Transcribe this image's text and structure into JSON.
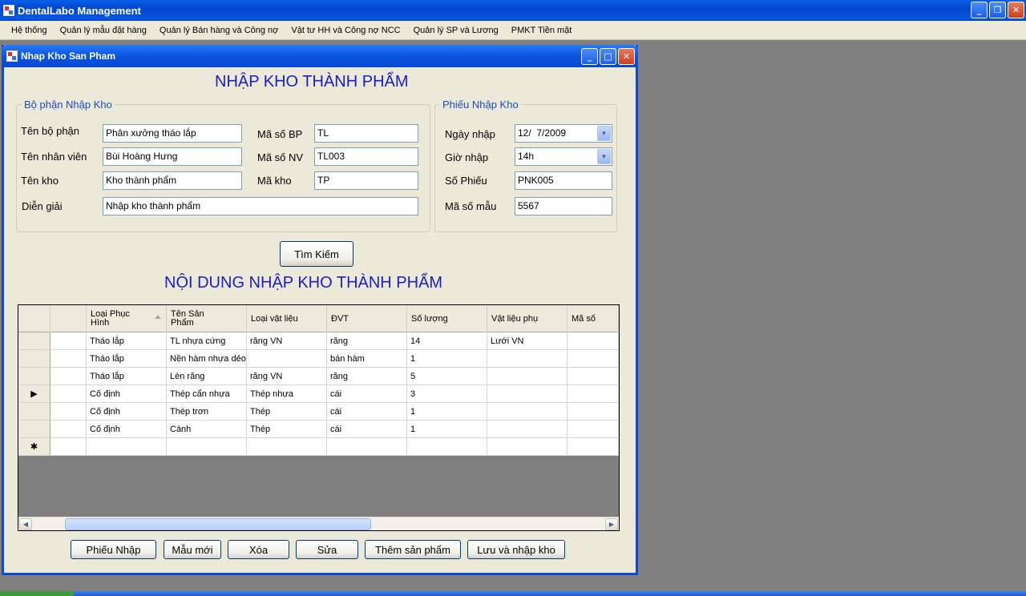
{
  "app": {
    "title": "DentalLabo Management"
  },
  "menu": [
    "Hệ thống",
    "Quản lý mẫu đặt hàng",
    "Quản lý Bán hàng và Công nợ",
    "Vật tư HH và Công nợ NCC",
    "Quản lý SP và Lương",
    "PMKT Tiền mặt"
  ],
  "window": {
    "title": "Nhap Kho San Pham"
  },
  "form": {
    "heading": "NHẬP KHO THÀNH PHẨM",
    "dept_group": "Bộ phận Nhập Kho",
    "receipt_group": "Phiếu Nhập Kho",
    "ten_bo_phan_label": "Tên bộ phận",
    "ten_bo_phan": "Phân xưởng tháo lắp",
    "ma_so_bp_label": "Mã số BP",
    "ma_so_bp": "TL",
    "ten_nhan_vien_label": "Tên nhân viên",
    "ten_nhan_vien": "Bùi Hoàng Hưng",
    "ma_so_nv_label": "Mã số NV",
    "ma_so_nv": "TL003",
    "ten_kho_label": "Tên kho",
    "ten_kho": "Kho thành phẩm",
    "ma_kho_label": "Mã kho",
    "ma_kho": "TP",
    "dien_giai_label": "Diễn giải",
    "dien_giai": "Nhập kho thành phẩm",
    "ngay_nhap_label": "Ngày nhập",
    "ngay_nhap": "12/  7/2009",
    "gio_nhap_label": "Giờ nhập",
    "gio_nhap": "14h",
    "so_phieu_label": "Số Phiếu",
    "so_phieu": "PNK005",
    "ma_so_mau_label": "Mã số mẫu",
    "ma_so_mau": "5567",
    "search_button": "Tìm Kiếm",
    "content_heading": "NỘI DUNG NHẬP KHO THÀNH PHẨM"
  },
  "grid": {
    "columns": [
      "",
      "Loại Phục\nHình",
      "Tên Sản\nPhẩm",
      "Loại vật liệu",
      "ĐVT",
      "Số lượng",
      "Vật liệu phụ",
      "Mã số"
    ],
    "rows": [
      [
        "",
        "Tháo lắp",
        "TL nhựa cứng",
        "răng VN",
        "răng",
        "14",
        "Lưới VN",
        ""
      ],
      [
        "",
        "Tháo lắp",
        "Nền hàm nhựa dẻo",
        "",
        "bán hàm",
        "1",
        "",
        ""
      ],
      [
        "",
        "Tháo lắp",
        "Lèn răng",
        "răng VN",
        "răng",
        "5",
        "",
        ""
      ],
      [
        "",
        "Cố định",
        "Thép cẩn nhựa",
        "Thép nhựa",
        "cái",
        "3",
        "",
        ""
      ],
      [
        "",
        "Cố định",
        "Thép trơn",
        "Thép",
        "cái",
        "1",
        "",
        ""
      ],
      [
        "",
        "Cố định",
        "Cánh",
        "Thép",
        "cái",
        "1",
        "",
        ""
      ]
    ],
    "current_row_marker": "▶",
    "new_row_marker": "✱"
  },
  "buttons": {
    "phieu_nhap": "Phiếu Nhập",
    "mau_moi": "Mẫu mới",
    "xoa": "Xóa",
    "sua": "Sửa",
    "them_san_pham": "Thêm sản phẩm",
    "luu_nhap_kho": "Lưu và nhập kho"
  }
}
